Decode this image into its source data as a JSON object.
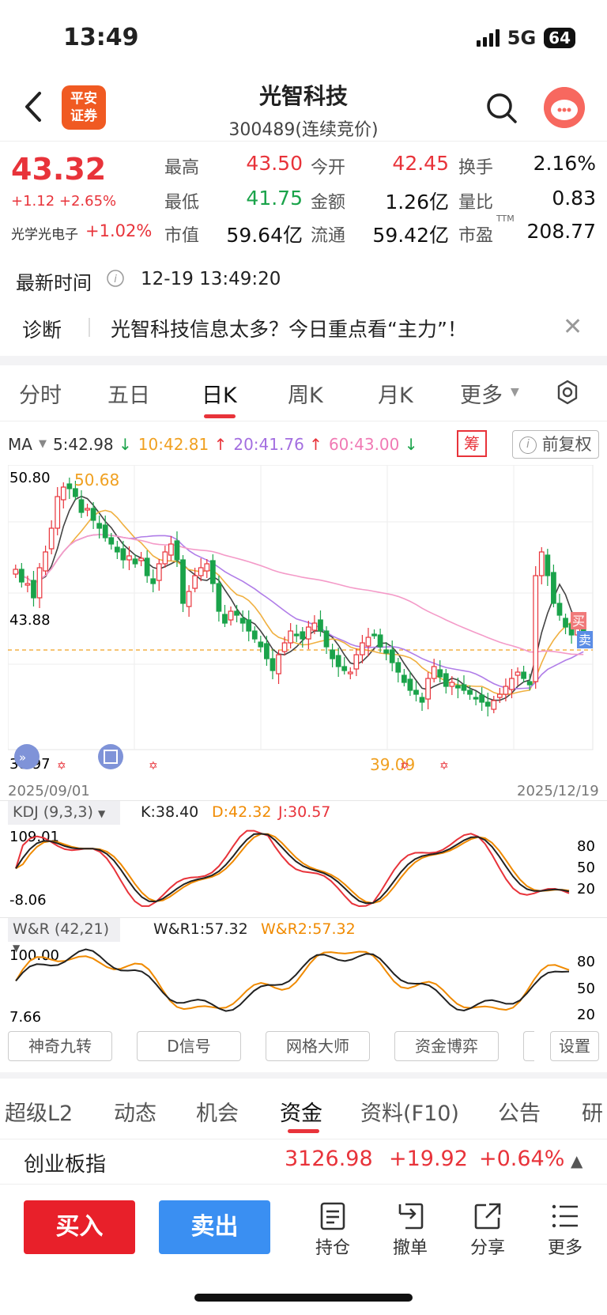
{
  "status": {
    "time": "13:49",
    "network": "5G",
    "battery": "64"
  },
  "header": {
    "broker_logo": [
      "平安",
      "证券"
    ],
    "stock_name": "光智科技",
    "stock_code": "300489(连续竞价)"
  },
  "quote": {
    "price": "43.32",
    "change": "+1.12 +2.65%",
    "sector_name": "光学光电子",
    "sector_change": "+1.02%",
    "fields": [
      {
        "label": "最高",
        "value": "43.50",
        "color": "red"
      },
      {
        "label": "今开",
        "value": "42.45",
        "color": "red"
      },
      {
        "label": "换手",
        "value": "2.16%",
        "color": "black"
      },
      {
        "label": "最低",
        "value": "41.75",
        "color": "green"
      },
      {
        "label": "金额",
        "value": "1.26亿",
        "color": "black"
      },
      {
        "label": "量比",
        "value": "0.83",
        "color": "black"
      },
      {
        "label": "市值",
        "value": "59.64亿",
        "color": "black"
      },
      {
        "label": "流通",
        "value": "59.42亿",
        "color": "black"
      },
      {
        "label": "市盈",
        "value": "208.77",
        "color": "black"
      }
    ],
    "pe_sup": "TTM"
  },
  "latest_time": {
    "label": "最新时间",
    "value": "12-19 13:49:20"
  },
  "diagnosis": {
    "label": "诊断",
    "text": "光智科技信息太多？今日重点看“主力”！"
  },
  "chart_tabs": [
    "分时",
    "五日",
    "日K",
    "周K",
    "月K",
    "更多"
  ],
  "active_chart_tab": "日K",
  "ma": {
    "label": "MA",
    "items": [
      {
        "text": "5:42.98",
        "arrow": "↓",
        "color": "#333333",
        "arrow_color": "#1aa34a"
      },
      {
        "text": "10:42.81",
        "arrow": "↑",
        "color": "#f0a020",
        "arrow_color": "#e8333a"
      },
      {
        "text": "20:41.76",
        "arrow": "↑",
        "color": "#a36ee0",
        "arrow_color": "#e8333a"
      },
      {
        "text": "60:43.00",
        "arrow": "↓",
        "color": "#f07ab4",
        "arrow_color": "#1aa34a"
      }
    ],
    "chou_label": "筹",
    "fq_label": "前复权"
  },
  "main_chart": {
    "y_top_label": "50.80",
    "y_mid_label": "43.88",
    "y_bottom_label": "38.97",
    "high_marker": "50.68",
    "low_marker": "39.09",
    "buy_tag": "买",
    "sell_tag": "卖",
    "start_date": "2025/09/01",
    "end_date": "2025/12/19"
  },
  "kdj": {
    "header": "KDJ (9,3,3)",
    "k": "K:38.40",
    "d": "D:42.32",
    "j": "J:30.57",
    "y_top": "109.01",
    "y_bottom": "-8.06",
    "levels": [
      "80",
      "50",
      "20"
    ]
  },
  "wr": {
    "header": "W&R (42,21)",
    "wr1": "W&R1:57.32",
    "wr2": "W&R2:57.32",
    "y_top": "100.00",
    "y_bottom": "7.66",
    "levels": [
      "80",
      "50",
      "20"
    ]
  },
  "tools": [
    "神奇九转",
    "D信号",
    "网格大师",
    "资金博弈",
    "设置"
  ],
  "bottom_tabs": [
    "超级L2",
    "动态",
    "机会",
    "资金",
    "资料(F10)",
    "公告",
    "研"
  ],
  "active_bottom_tab": "资金",
  "index_row": {
    "name": "创业板指",
    "value": "3126.98",
    "change": "+19.92",
    "pct": "+0.64%"
  },
  "actions": {
    "buy": "买入",
    "sell": "卖出",
    "items": [
      "持仓",
      "撤单",
      "分享",
      "更多"
    ]
  }
}
